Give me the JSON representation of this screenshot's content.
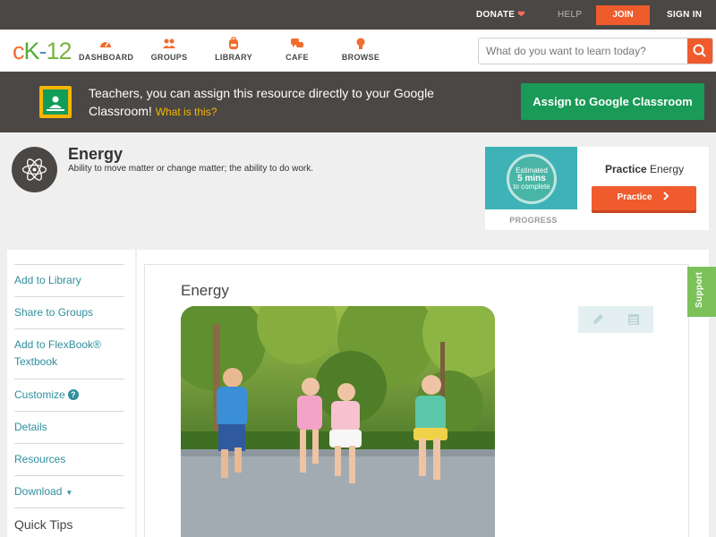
{
  "topbar": {
    "donate": "DONATE",
    "help": "HELP",
    "join": "JOIN",
    "signin": "SIGN IN"
  },
  "nav": {
    "logo": {
      "c": "c",
      "k": "K",
      "dash": "-",
      "num": "12"
    },
    "items": [
      {
        "label": "DASHBOARD",
        "icon": "gauge-icon"
      },
      {
        "label": "GROUPS",
        "icon": "people-icon"
      },
      {
        "label": "LIBRARY",
        "icon": "backpack-icon"
      },
      {
        "label": "CAFE",
        "icon": "chat-bubbles-icon"
      },
      {
        "label": "BROWSE",
        "icon": "lightbulb-icon"
      }
    ],
    "search": {
      "placeholder": "What do you want to learn today?"
    }
  },
  "banner": {
    "text": "Teachers, you can assign this resource directly to your Google Classroom!",
    "link": "What is this?",
    "assign": "Assign to Google Classroom"
  },
  "concept": {
    "title": "Energy",
    "description": "Ability to move matter or change matter; the ability to do work."
  },
  "practice": {
    "estimated_line1": "Estimated",
    "estimated_line2": "5 mins",
    "estimated_line3": "to complete",
    "progress": "PROGRESS",
    "title_bold": "Practice",
    "title_rest": "Energy",
    "button": "Practice"
  },
  "sidebar": {
    "items": [
      "Add to Library",
      "Share to Groups",
      "Add to FlexBook® Textbook",
      "Customize",
      "Details",
      "Resources",
      "Download",
      "Quick Tips"
    ]
  },
  "content": {
    "title": "Energy"
  },
  "support": "Support",
  "colors": {
    "accent": "#ef5b2d",
    "dark": "#4a4744",
    "classroom_green": "#1a9a57",
    "link": "#2f8f9d",
    "support_green": "#7cc15a"
  }
}
